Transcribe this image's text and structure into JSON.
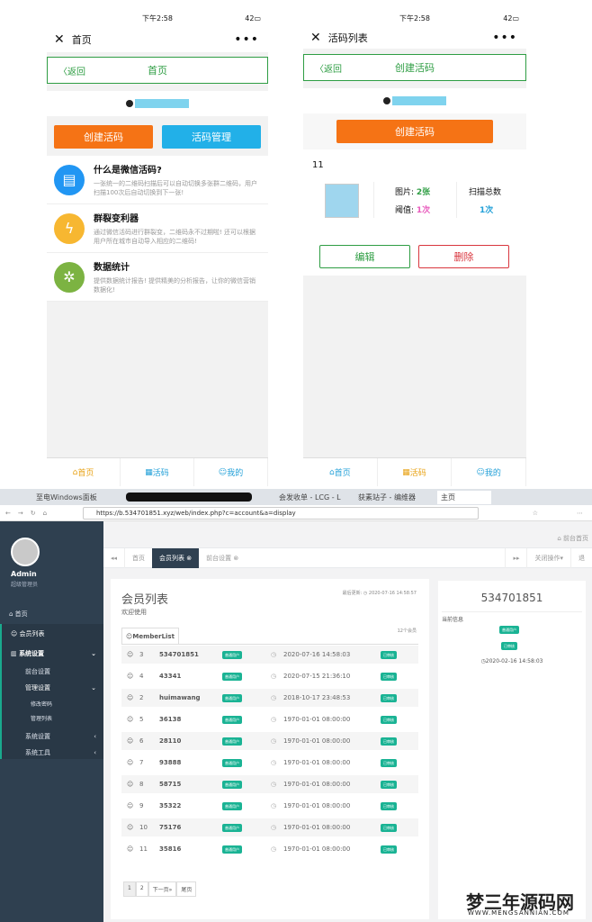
{
  "phone1": {
    "status": {
      "time": "下午2:58",
      "battery": "42"
    },
    "title": "首页",
    "greenbar": {
      "back": "〈返回",
      "title": "首页"
    },
    "buttons": {
      "create": "创建活码",
      "manage": "活码管理"
    },
    "features": [
      {
        "title": "什么是微信活码?",
        "desc": "一张统一的二维码扫描后可以自动切换多张群二维码，用户扫描100次后自动切换到下一张!",
        "color": "#2196f3",
        "icon": "clipboard-icon"
      },
      {
        "title": "群裂变利器",
        "desc": "通过微信活码进行群裂变，二维码永不过期啦! 还可以根据用户所在城市自动导入相应的二维码!",
        "color": "#f7b731",
        "icon": "lightning-icon"
      },
      {
        "title": "数据统计",
        "desc": "提供数据统计报告! 提供精美的分析报告，让你的微信营销数据化!",
        "color": "#7cb342",
        "icon": "gear-icon"
      }
    ],
    "tabs": [
      "首页",
      "活码",
      "我的"
    ]
  },
  "phone2": {
    "status": {
      "time": "下午2:58",
      "battery": "42"
    },
    "title": "活码列表",
    "greenbar": {
      "back": "〈返回",
      "title": "创建活码"
    },
    "create": "创建活码",
    "card": {
      "name": "11",
      "pics_label": "图片:",
      "pics_value": "2张",
      "threshold_label": "阈值:",
      "threshold_value": "1次",
      "scan_label": "扫描总数",
      "scan_value": "1次"
    },
    "edit": "编辑",
    "delete": "删除",
    "tabs": [
      "首页",
      "活码",
      "我的"
    ]
  },
  "browser": {
    "tabs": [
      "至电Windows面板",
      "会发收单 - LCG - L",
      "获素站子 - 编维器",
      "主页"
    ],
    "url": "https://b.534701851.xyz/web/index.php?c=account&a=display"
  },
  "sidebar": {
    "user": "Admin",
    "role": "超级管理员",
    "items": [
      "首页",
      "会员列表",
      "系统设置",
      "前台设置",
      "管理设置",
      "修改密码",
      "管理列表",
      "系统设置",
      "系统工具"
    ]
  },
  "top": {
    "front": "前台首页",
    "close_ops": "关闭操作",
    "back": "退"
  },
  "navtabs": [
    "首页",
    "会员列表",
    "前台设置"
  ],
  "list": {
    "title": "会员列表",
    "welcome": "欢迎使用",
    "updated": "最后更新: ◷ 2020-07-16 14:58:57",
    "tab": "MemberList",
    "count": "12个会员",
    "rows": [
      {
        "id": "3",
        "name": "534701851",
        "type": "普通用户",
        "time": "2020-07-16 14:58:03",
        "status": "已审核"
      },
      {
        "id": "4",
        "name": "43341",
        "type": "普通用户",
        "time": "2020-07-15 21:36:10",
        "status": "已审核"
      },
      {
        "id": "2",
        "name": "huimawang",
        "type": "普通用户",
        "time": "2018-10-17 23:48:53",
        "status": "已审核"
      },
      {
        "id": "5",
        "name": "36138",
        "type": "普通用户",
        "time": "1970-01-01 08:00:00",
        "status": "已审核"
      },
      {
        "id": "6",
        "name": "28110",
        "type": "普通用户",
        "time": "1970-01-01 08:00:00",
        "status": "已审核"
      },
      {
        "id": "7",
        "name": "93888",
        "type": "普通用户",
        "time": "1970-01-01 08:00:00",
        "status": "已审核"
      },
      {
        "id": "8",
        "name": "58715",
        "type": "普通用户",
        "time": "1970-01-01 08:00:00",
        "status": "已审核"
      },
      {
        "id": "9",
        "name": "35322",
        "type": "普通用户",
        "time": "1970-01-01 08:00:00",
        "status": "已审核"
      },
      {
        "id": "10",
        "name": "75176",
        "type": "普通用户",
        "time": "1970-01-01 08:00:00",
        "status": "已审核"
      },
      {
        "id": "11",
        "name": "35816",
        "type": "普通用户",
        "time": "1970-01-01 08:00:00",
        "status": "已审核"
      }
    ],
    "pager": [
      "1",
      "2",
      "下一页»",
      "尾页"
    ]
  },
  "detail": {
    "name": "534701851",
    "info_label": "当前信息",
    "type": "普通用户",
    "status": "已审核",
    "time": "◷2020-02-16 14:58:03"
  },
  "watermark": {
    "title": "梦三年源码网",
    "url": "WWW.MENGSANNIAN.COM"
  }
}
